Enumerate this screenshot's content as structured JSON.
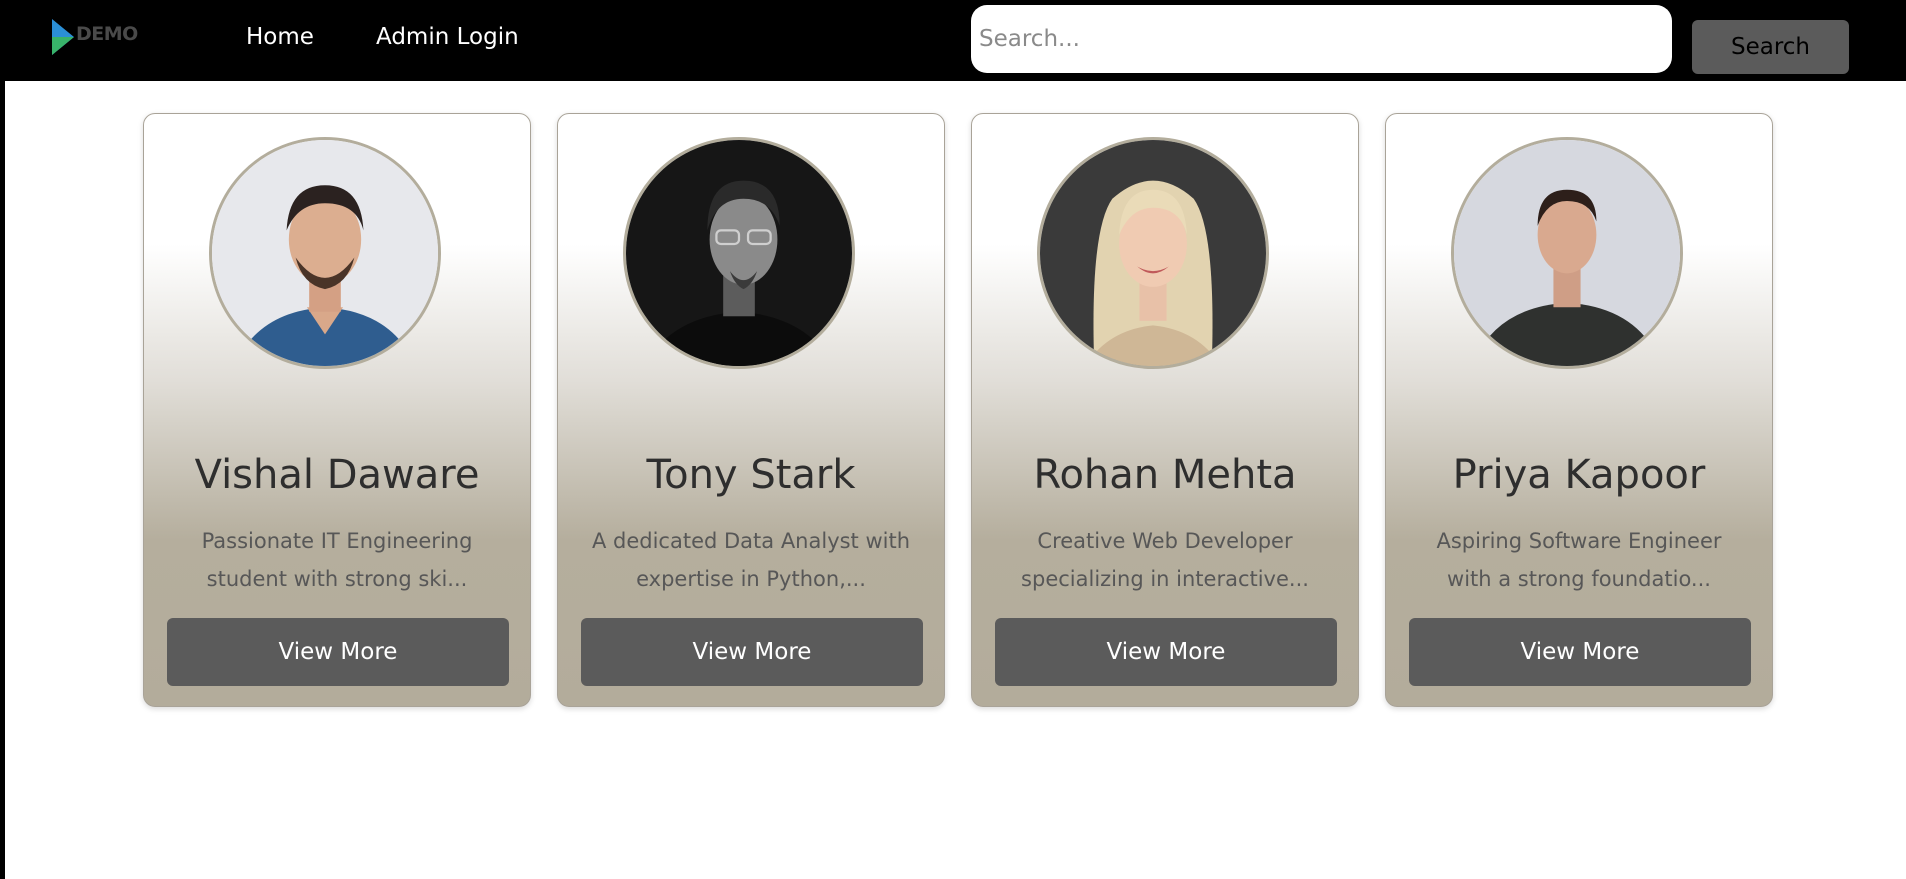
{
  "navbar": {
    "logo_text": "DEMO",
    "links": [
      {
        "label": "Home"
      },
      {
        "label": "Admin Login"
      }
    ],
    "search": {
      "placeholder": "Search...",
      "value": "",
      "button_label": "Search"
    }
  },
  "cards": [
    {
      "name": "Vishal Daware",
      "desc_line1": "Passionate IT Engineering",
      "desc_line2": "student with strong ski...",
      "button_label": "View More",
      "avatar_icon": "man-blue-shirt-photo"
    },
    {
      "name": "Tony Stark",
      "desc_line1": "A dedicated Data Analyst with",
      "desc_line2": "expertise in Python,...",
      "button_label": "View More",
      "avatar_icon": "man-glasses-bw-photo"
    },
    {
      "name": "Rohan Mehta",
      "desc_line1": "Creative Web Developer",
      "desc_line2": "specializing in interactive...",
      "button_label": "View More",
      "avatar_icon": "woman-blonde-photo"
    },
    {
      "name": "Priya Kapoor",
      "desc_line1": "Aspiring Software Engineer",
      "desc_line2": "with a strong foundatio...",
      "button_label": "View More",
      "avatar_icon": "man-dark-shirt-photo"
    }
  ],
  "colors": {
    "navbar_bg": "#000000",
    "button_bg": "#5b5b5b",
    "card_gradient_end": "#b3ac9b"
  }
}
